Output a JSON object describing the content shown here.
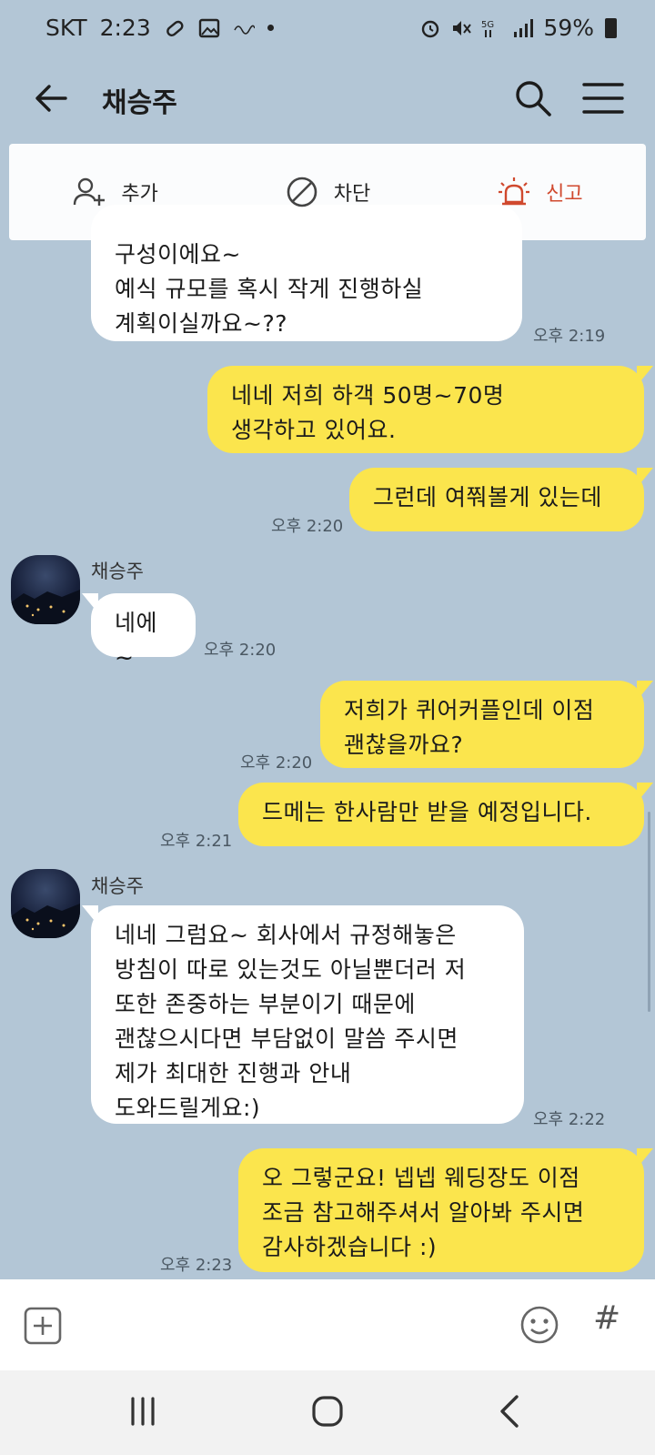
{
  "status_bar": {
    "carrier": "SKT",
    "time": "2:23",
    "battery": "59%"
  },
  "header": {
    "title": "채승주"
  },
  "action_bar": {
    "add_label": "추가",
    "block_label": "차단",
    "report_label": "신고"
  },
  "messages": [
    {
      "side": "in",
      "text": "구성이에요~\n예식 규모를 혹시 작게 진행하실\n계획이실까요~??",
      "time": "오후 2:19"
    },
    {
      "side": "out",
      "text": "네네 저희 하객 50명~70명\n생각하고 있어요."
    },
    {
      "side": "out",
      "text": "그런데 여쭤볼게 있는데",
      "time": "오후 2:20"
    },
    {
      "side": "in",
      "sender": "채승주",
      "text": "네에~",
      "time": "오후 2:20"
    },
    {
      "side": "out",
      "text": "저희가 퀴어커플인데 이점\n괜찮을까요?",
      "time": "오후 2:20"
    },
    {
      "side": "out",
      "text": "드메는 한사람만 받을 예정입니다.",
      "time": "오후 2:21"
    },
    {
      "side": "in",
      "sender": "채승주",
      "text": "네네 그럼요~ 회사에서 규정해놓은\n방침이 따로 있는것도 아닐뿐더러 저\n또한 존중하는 부분이기 때문에\n괜찮으시다면 부담없이 말씀 주시면\n제가 최대한 진행과 안내\n도와드릴게요:)",
      "time": "오후 2:22"
    },
    {
      "side": "out",
      "text": "오 그렇군요! 넵넵 웨딩장도 이점\n조금 참고해주셔서 알아봐 주시면\n감사하겠습니다 :)",
      "time": "오후 2:23"
    }
  ],
  "input_bar": {
    "hash_label": "#"
  },
  "colors": {
    "chat_background": "#b3c6d6",
    "outgoing_bubble": "#fbe54d",
    "incoming_bubble": "#ffffff",
    "report_accent": "#d0492e"
  },
  "icons": [
    "back-arrow-icon",
    "search-icon",
    "menu-icon",
    "add-friend-icon",
    "block-icon",
    "siren-icon",
    "plus-icon",
    "emoji-icon",
    "recents-icon",
    "home-icon",
    "nav-back-icon"
  ]
}
